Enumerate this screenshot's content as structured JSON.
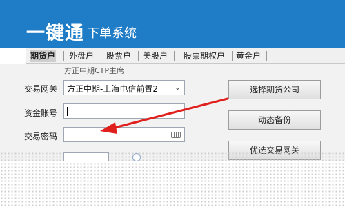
{
  "app": {
    "title": "一键通",
    "subtitle": "下单系统"
  },
  "tabs": [
    {
      "label": "期货户",
      "active": true
    },
    {
      "label": "外盘户",
      "active": false
    },
    {
      "label": "股票户",
      "active": false
    },
    {
      "label": "美股户",
      "active": false
    },
    {
      "label": "股票期权户",
      "active": false
    },
    {
      "label": "黄金户",
      "active": false
    }
  ],
  "panel": {
    "header": "方正中期CTP主席"
  },
  "form": {
    "gateway_label": "交易网关",
    "gateway_value": "方正中期-上海电信前置2",
    "account_label": "资金账号",
    "account_value": "",
    "password_label": "交易密码",
    "password_value": ""
  },
  "buttons": {
    "select_broker": "选择期货公司",
    "dynamic_backup": "动态备份",
    "optimize_gateway": "优选交易网关"
  },
  "annotation": {
    "arrow_color": "#e0201c"
  }
}
